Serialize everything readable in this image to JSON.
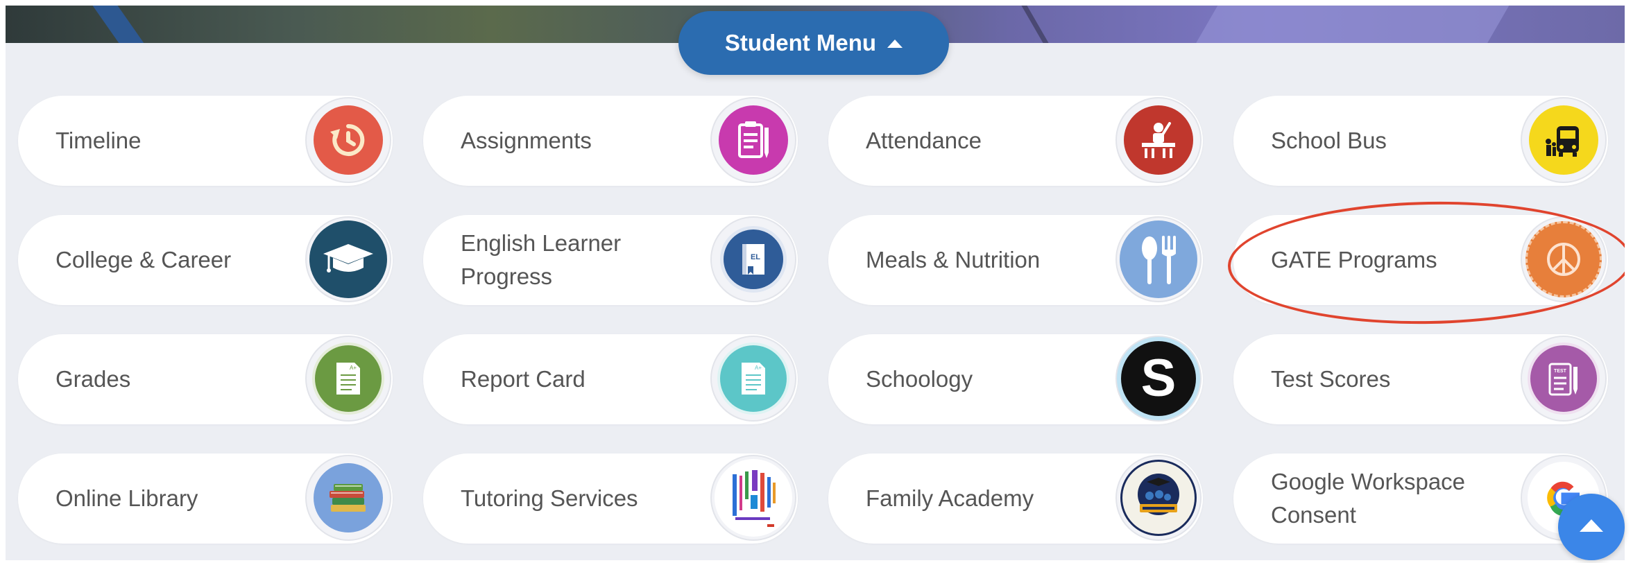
{
  "menu": {
    "label": "Student Menu",
    "caret": "caret-up-icon"
  },
  "tiles": [
    {
      "label": "Timeline",
      "icon": "history-icon",
      "color": "#e35a48"
    },
    {
      "label": "Assignments",
      "icon": "clipboard-icon",
      "color": "#c83aae"
    },
    {
      "label": "Attendance",
      "icon": "student-desk-icon",
      "color": "#c0372d"
    },
    {
      "label": "School Bus",
      "icon": "school-bus-icon",
      "color": "#f5d81c"
    },
    {
      "label": "College & Career",
      "icon": "graduation-cap-icon",
      "color": "#1f4f6a"
    },
    {
      "label": "English Learner Progress",
      "icon": "el-book-icon",
      "color": "#2f5c98",
      "badge": "EL"
    },
    {
      "label": "Meals & Nutrition",
      "icon": "spoon-fork-icon",
      "color": "#7fa8dc"
    },
    {
      "label": "GATE Programs",
      "icon": "peace-badge-icon",
      "color": "#e77f3b"
    },
    {
      "label": "Grades",
      "icon": "graded-paper-icon",
      "color": "#6b9a42",
      "badge": "A+"
    },
    {
      "label": "Report Card",
      "icon": "report-card-icon",
      "color": "#5cc6c8",
      "badge": "A+"
    },
    {
      "label": "Schoology",
      "icon": "schoology-icon",
      "color": "#111111",
      "badge": "S"
    },
    {
      "label": "Test Scores",
      "icon": "test-scores-icon",
      "color": "#a55aa8",
      "badge": "TEST"
    },
    {
      "label": "Online Library",
      "icon": "books-icon",
      "color": "#7aa2dc"
    },
    {
      "label": "Tutoring Services",
      "icon": "word-cloud-icon",
      "color": "#ffffff"
    },
    {
      "label": "Family Academy",
      "icon": "family-academy-icon",
      "color": "#1a2b5c"
    },
    {
      "label": "Google Workspace Consent",
      "icon": "google-icon",
      "color": "#ffffff"
    }
  ],
  "annotation": {
    "target": "GATE Programs",
    "color": "#e0442e"
  },
  "scroll_top": {
    "icon": "arrow-up-icon",
    "color": "#3b86e8"
  }
}
